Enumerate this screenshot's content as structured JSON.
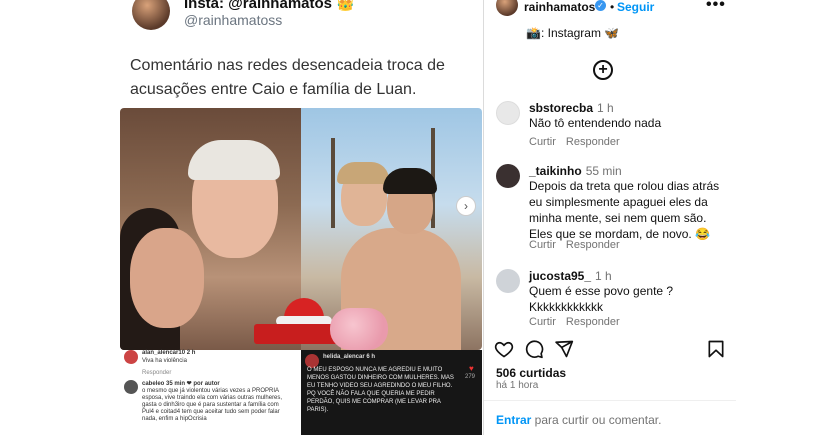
{
  "tweet": {
    "name": "Insta: @rainhamatos 👑",
    "handle": "@rainhamatoss",
    "text": "Comentário nas redes desencadeia troca de acusações entre Caio e família de Luan.",
    "comments_left": [
      {
        "name": "alan_alencar10 2 h",
        "text": "Viva ha violência",
        "reply": "Responder"
      },
      {
        "name": "cabeleo 35 min ❤ por autor",
        "text": "o mesmo que já violentou várias vezes a PROPRIA esposa, vive traindo ela com várias outras mulheres, gasta o dinh3iro que é para sustentar a família com Pul4 e coitad4 tem que aceitar tudo sem poder falar nada, enfim a hipOcrisia"
      }
    ],
    "comment_right": {
      "name": "helida_alencar 6 h",
      "text": "o meu esposo nunca me agrediu e muito menos gastou dinheiro com mulheres. mas eu tenho video seu agredindo o meu filho. pq você não fala que queria me pedir perdão, quis me comprar (me levar pra paris).",
      "likes": "279"
    },
    "gallery_arrow": "›"
  },
  "instagram": {
    "username": "rainhamatos",
    "verified": "✓",
    "dot": "•",
    "follow": "Seguir",
    "more": "•••",
    "caption": "📸: Instagram 🦋",
    "caption_prefix": "📸: Instagram",
    "caption_emoji": "🦋",
    "comments": [
      {
        "user": "sbstorecba",
        "time": "1 h",
        "text": "Não tô entendendo nada",
        "reply": "Curtir",
        "reply2": "Responder",
        "avatar_color": "#e8e8e8"
      },
      {
        "user": "_taikinho",
        "time": "55 min",
        "text": "Depois da treta que rolou dias atrás eu simplesmente apaguei eles da minha mente, sei nem quem são. Eles que se mordam, de novo. 😂",
        "reply": "Curtir",
        "reply2": "Responder",
        "avatar_color": "#3a3030"
      },
      {
        "user": "jucosta95_",
        "time": "1 h",
        "text": "Quem é esse povo gente ? Kkkkkkkkkkkk",
        "reply": "Curtir",
        "reply2": "Responder",
        "avatar_color": "#cfd3d8"
      }
    ],
    "likes": "506 curtidas",
    "time_ago": "há 1 hora",
    "login_link": "Entrar",
    "login_text": " para curtir ou comentar."
  }
}
